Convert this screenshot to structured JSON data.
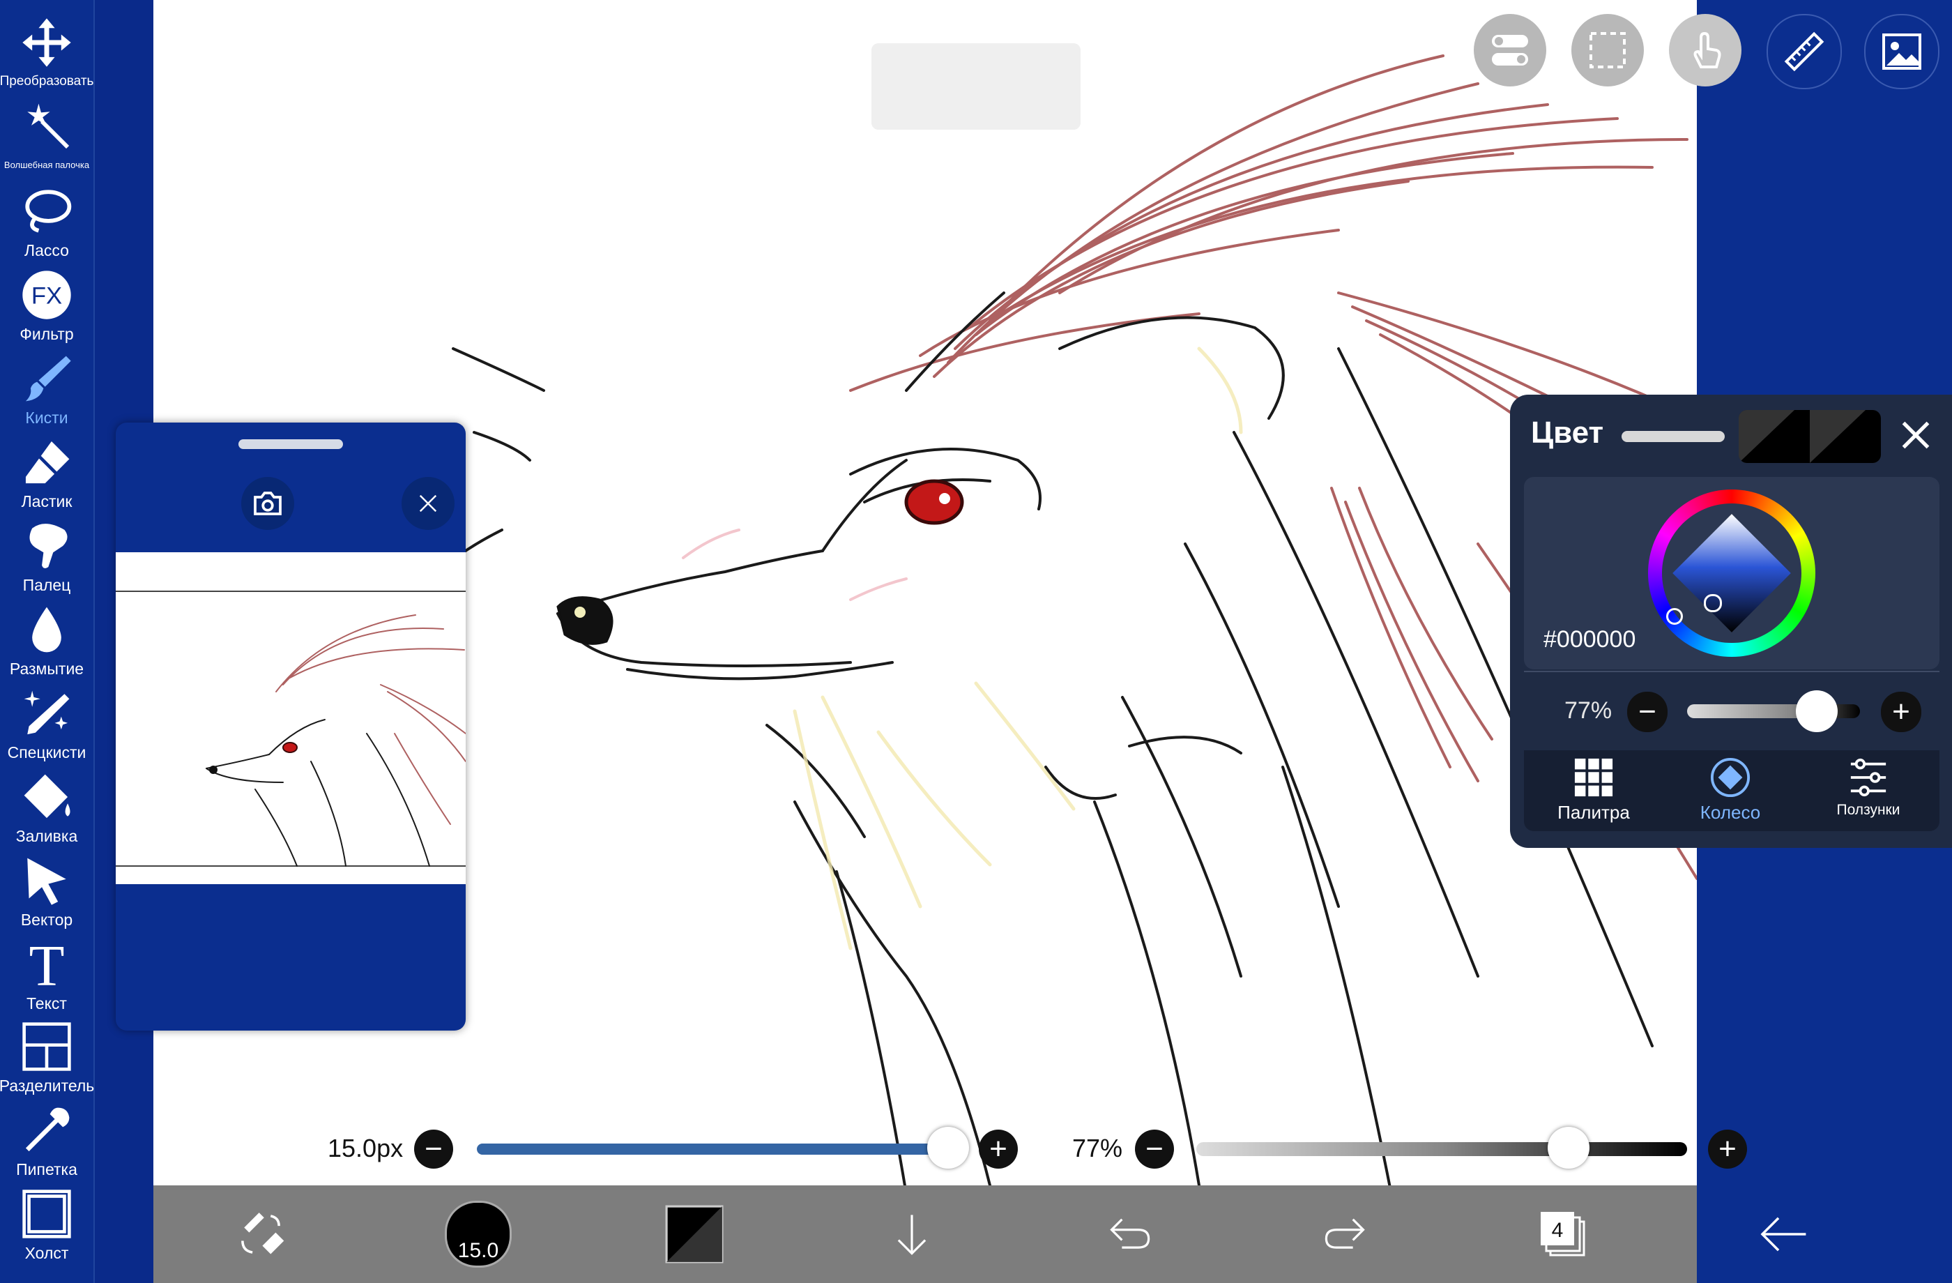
{
  "toolbar": {
    "items": [
      {
        "label": "Преобразовать",
        "icon": "move-icon"
      },
      {
        "label": "Волшебная палочка",
        "icon": "magic-wand-icon"
      },
      {
        "label": "Лассо",
        "icon": "lasso-icon"
      },
      {
        "label": "Фильтр",
        "icon": "fx-icon"
      },
      {
        "label": "Кисти",
        "icon": "brush-icon",
        "active": true
      },
      {
        "label": "Ластик",
        "icon": "eraser-icon"
      },
      {
        "label": "Палец",
        "icon": "smudge-finger-icon"
      },
      {
        "label": "Размытие",
        "icon": "blur-drop-icon"
      },
      {
        "label": "Спецкисти",
        "icon": "special-brush-icon"
      },
      {
        "label": "Заливка",
        "icon": "fill-bucket-icon"
      },
      {
        "label": "Вектор",
        "icon": "vector-cursor-icon"
      },
      {
        "label": "Текст",
        "icon": "text-icon"
      },
      {
        "label": "Разделитель",
        "icon": "frame-divider-icon"
      },
      {
        "label": "Пипетка",
        "icon": "eyedropper-icon"
      },
      {
        "label": "Холст",
        "icon": "canvas-icon"
      }
    ],
    "fx_text": "FX",
    "text_glyph": "T"
  },
  "top_buttons": [
    "toggle-icon",
    "selection-icon",
    "touch-hand-icon",
    "ruler-icon",
    "image-icon"
  ],
  "brush": {
    "size_label": "15.0px",
    "size_fraction": 0.98,
    "opacity_label": "77%",
    "opacity_fraction": 0.77,
    "minus": "−",
    "plus": "+"
  },
  "bottom_bar": {
    "brush_badge": "15.0",
    "layer_count": "4",
    "icons": [
      "swap-brush-eraser-icon",
      "brush-size-icon",
      "color-swatch-icon",
      "down-arrow-icon",
      "undo-icon",
      "redo-icon",
      "layers-icon",
      "back-arrow-icon"
    ]
  },
  "color_panel": {
    "title": "Цвет",
    "hex": "#000000",
    "opacity_label": "77%",
    "opacity_fraction": 0.77,
    "tabs": [
      {
        "label": "Палитра",
        "icon": "grid-icon"
      },
      {
        "label": "Колесо",
        "icon": "wheel-icon",
        "active": true
      },
      {
        "label": "Ползунки",
        "icon": "sliders-icon"
      }
    ]
  },
  "colors": {
    "toolbar_bg": "#0b2e8f",
    "accent": "#7fb6ff",
    "sketch_red": "#9b3a3a",
    "bottom_bar": "#7d7d7d",
    "slider_fill": "#3465a4"
  }
}
